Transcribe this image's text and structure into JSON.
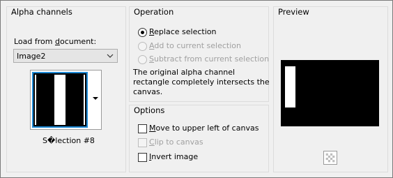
{
  "alpha_channels": {
    "title": "Alpha channels",
    "load_from_label_pre": "Load from ",
    "load_from_label_u": "d",
    "load_from_label_post": "ocument:",
    "document_value": "Image2",
    "selection_name": "S�lection #8"
  },
  "operation": {
    "title": "Operation",
    "options": [
      {
        "pre": "",
        "u": "R",
        "post": "eplace selection",
        "selected": true,
        "enabled": true
      },
      {
        "pre": "",
        "u": "A",
        "post": "dd to current selection",
        "selected": false,
        "enabled": false
      },
      {
        "pre": "",
        "u": "S",
        "post": "ubtract from current selection",
        "selected": false,
        "enabled": false
      }
    ],
    "description_line1": "The original alpha channel",
    "description_line2": "rectangle completely intersects the",
    "description_line3": "canvas."
  },
  "options": {
    "title": "Options",
    "items": [
      {
        "pre": "",
        "u": "M",
        "post": "ove to upper left of canvas",
        "checked": false,
        "enabled": true
      },
      {
        "pre": "",
        "u": "C",
        "post": "lip to canvas",
        "checked": false,
        "enabled": false
      },
      {
        "pre": "",
        "u": "I",
        "post": "nvert image",
        "checked": false,
        "enabled": true
      }
    ]
  },
  "preview": {
    "title": "Preview"
  },
  "icons": {
    "dropdown": "chevron-down-icon",
    "thumbnail_menu": "triangle-down-icon",
    "zoom": "zoom-checker-icon"
  },
  "colors": {
    "accent": "#1e8ad6",
    "disabled_text": "#a0a0a0"
  }
}
